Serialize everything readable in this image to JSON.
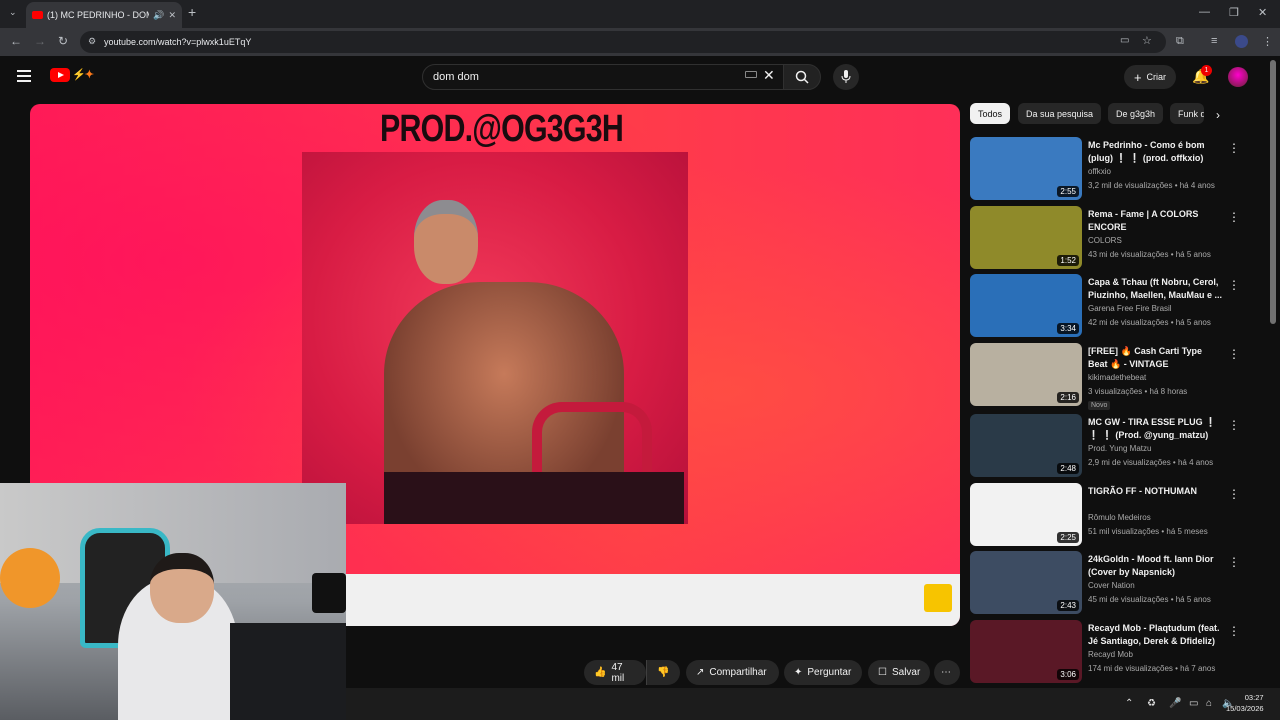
{
  "browser": {
    "tab_title": "(1) MC PEDRINHO - DOM D",
    "url": "youtube.com/watch?v=plwxk1uETqY"
  },
  "header": {
    "search_value": "dom dom",
    "create_label": "Criar",
    "notifications_count": "1"
  },
  "player": {
    "overlay_text": "PROD.@OG3G3H"
  },
  "actions": {
    "likes": "47 mil",
    "share": "Compartilhar",
    "ask": "Perguntar",
    "save": "Salvar"
  },
  "chips": [
    "Todos",
    "Da sua pesquisa",
    "De g3g3h",
    "Funk d"
  ],
  "recommendations": [
    {
      "title": "Mc Pedrinho - Como é bom (plug) ❕ ❕ (prod. offkxio)",
      "channel": "offkxio",
      "meta": "3,2 mil de visualizações • há 4 anos",
      "duration": "2:55",
      "thumb": "#3a7ac0"
    },
    {
      "title": "Rema - Fame | A COLORS ENCORE",
      "channel": "COLORS",
      "meta": "43 mi de visualizações • há 5 anos",
      "duration": "1:52",
      "thumb": "#8f8a2a"
    },
    {
      "title": "Capa & Tchau (ft Nobru, Cerol, Piuzinho, Maellen, MauMau e ...",
      "channel": "Garena Free Fire Brasil",
      "meta": "42 mi de visualizações • há 5 anos",
      "duration": "3:34",
      "thumb": "#2a6fb8"
    },
    {
      "title": "[FREE] 🔥 Cash Carti Type Beat 🔥 - VINTAGE",
      "channel": "kikimadethebeat",
      "meta": "3 visualizações • há 8 horas",
      "duration": "2:16",
      "thumb": "#b8b0a0",
      "badge": "Novo"
    },
    {
      "title": "MC GW - TIRA ESSE PLUG ❕ ❕ ❕ (Prod. @yung_matzu)",
      "channel": "Prod. Yung Matzu",
      "meta": "2,9 mi de visualizações • há 4 anos",
      "duration": "2:48",
      "thumb": "#2a3a48"
    },
    {
      "title": "TIGRÃO FF - NOTHUMAN",
      "channel": "Rômulo Medeiros",
      "meta": "51 mil visualizações • há 5 meses",
      "duration": "2:25",
      "thumb": "#f2f2f2"
    },
    {
      "title": "24kGoldn - Mood ft. Iann Dior (Cover by Napsnick)",
      "channel": "Cover Nation",
      "meta": "45 mi de visualizações • há 5 anos",
      "duration": "2:43",
      "thumb": "#3d4c62"
    },
    {
      "title": "Recayd Mob - Plaqtudum (feat. Jé Santiago, Derek & Dfideliz) ...",
      "channel": "Recayd Mob",
      "meta": "174 mi de visualizações • há 7 anos",
      "duration": "3:06",
      "thumb": "#5a1826"
    }
  ],
  "taskbar": {
    "time": "03:27",
    "date": "15/03/2026"
  },
  "colors": {
    "accent": "#ff0000",
    "background": "#0f0f0f"
  }
}
